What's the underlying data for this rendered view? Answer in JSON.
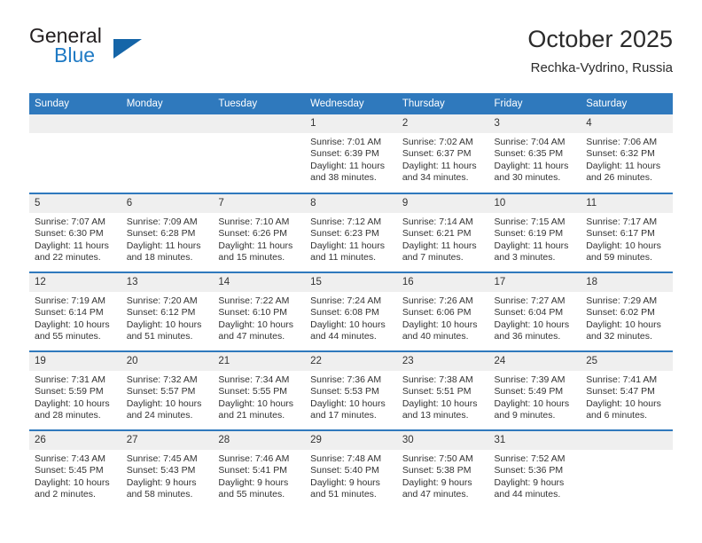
{
  "brand": {
    "name_top": "General",
    "name_bottom": "Blue",
    "triangle_icon": "triangle-icon",
    "color_dark": "#231f20",
    "color_blue": "#1f7ac4"
  },
  "header": {
    "title": "October 2025",
    "location": "Rechka-Vydrino, Russia"
  },
  "theme": {
    "header_blue": "#2f79bd",
    "row_divider": "#2f79bd",
    "daynum_band": "#efefef",
    "text": "#333333"
  },
  "calendar": {
    "weekdays": [
      "Sunday",
      "Monday",
      "Tuesday",
      "Wednesday",
      "Thursday",
      "Friday",
      "Saturday"
    ],
    "labels": {
      "sunrise": "Sunrise:",
      "sunset": "Sunset:",
      "daylight": "Daylight:"
    },
    "weeks": [
      [
        {
          "day": "",
          "empty": true
        },
        {
          "day": "",
          "empty": true
        },
        {
          "day": "",
          "empty": true
        },
        {
          "day": "1",
          "sunrise": "Sunrise: 7:01 AM",
          "sunset": "Sunset: 6:39 PM",
          "daylight1": "Daylight: 11 hours",
          "daylight2": "and 38 minutes."
        },
        {
          "day": "2",
          "sunrise": "Sunrise: 7:02 AM",
          "sunset": "Sunset: 6:37 PM",
          "daylight1": "Daylight: 11 hours",
          "daylight2": "and 34 minutes."
        },
        {
          "day": "3",
          "sunrise": "Sunrise: 7:04 AM",
          "sunset": "Sunset: 6:35 PM",
          "daylight1": "Daylight: 11 hours",
          "daylight2": "and 30 minutes."
        },
        {
          "day": "4",
          "sunrise": "Sunrise: 7:06 AM",
          "sunset": "Sunset: 6:32 PM",
          "daylight1": "Daylight: 11 hours",
          "daylight2": "and 26 minutes."
        }
      ],
      [
        {
          "day": "5",
          "sunrise": "Sunrise: 7:07 AM",
          "sunset": "Sunset: 6:30 PM",
          "daylight1": "Daylight: 11 hours",
          "daylight2": "and 22 minutes."
        },
        {
          "day": "6",
          "sunrise": "Sunrise: 7:09 AM",
          "sunset": "Sunset: 6:28 PM",
          "daylight1": "Daylight: 11 hours",
          "daylight2": "and 18 minutes."
        },
        {
          "day": "7",
          "sunrise": "Sunrise: 7:10 AM",
          "sunset": "Sunset: 6:26 PM",
          "daylight1": "Daylight: 11 hours",
          "daylight2": "and 15 minutes."
        },
        {
          "day": "8",
          "sunrise": "Sunrise: 7:12 AM",
          "sunset": "Sunset: 6:23 PM",
          "daylight1": "Daylight: 11 hours",
          "daylight2": "and 11 minutes."
        },
        {
          "day": "9",
          "sunrise": "Sunrise: 7:14 AM",
          "sunset": "Sunset: 6:21 PM",
          "daylight1": "Daylight: 11 hours",
          "daylight2": "and 7 minutes."
        },
        {
          "day": "10",
          "sunrise": "Sunrise: 7:15 AM",
          "sunset": "Sunset: 6:19 PM",
          "daylight1": "Daylight: 11 hours",
          "daylight2": "and 3 minutes."
        },
        {
          "day": "11",
          "sunrise": "Sunrise: 7:17 AM",
          "sunset": "Sunset: 6:17 PM",
          "daylight1": "Daylight: 10 hours",
          "daylight2": "and 59 minutes."
        }
      ],
      [
        {
          "day": "12",
          "sunrise": "Sunrise: 7:19 AM",
          "sunset": "Sunset: 6:14 PM",
          "daylight1": "Daylight: 10 hours",
          "daylight2": "and 55 minutes."
        },
        {
          "day": "13",
          "sunrise": "Sunrise: 7:20 AM",
          "sunset": "Sunset: 6:12 PM",
          "daylight1": "Daylight: 10 hours",
          "daylight2": "and 51 minutes."
        },
        {
          "day": "14",
          "sunrise": "Sunrise: 7:22 AM",
          "sunset": "Sunset: 6:10 PM",
          "daylight1": "Daylight: 10 hours",
          "daylight2": "and 47 minutes."
        },
        {
          "day": "15",
          "sunrise": "Sunrise: 7:24 AM",
          "sunset": "Sunset: 6:08 PM",
          "daylight1": "Daylight: 10 hours",
          "daylight2": "and 44 minutes."
        },
        {
          "day": "16",
          "sunrise": "Sunrise: 7:26 AM",
          "sunset": "Sunset: 6:06 PM",
          "daylight1": "Daylight: 10 hours",
          "daylight2": "and 40 minutes."
        },
        {
          "day": "17",
          "sunrise": "Sunrise: 7:27 AM",
          "sunset": "Sunset: 6:04 PM",
          "daylight1": "Daylight: 10 hours",
          "daylight2": "and 36 minutes."
        },
        {
          "day": "18",
          "sunrise": "Sunrise: 7:29 AM",
          "sunset": "Sunset: 6:02 PM",
          "daylight1": "Daylight: 10 hours",
          "daylight2": "and 32 minutes."
        }
      ],
      [
        {
          "day": "19",
          "sunrise": "Sunrise: 7:31 AM",
          "sunset": "Sunset: 5:59 PM",
          "daylight1": "Daylight: 10 hours",
          "daylight2": "and 28 minutes."
        },
        {
          "day": "20",
          "sunrise": "Sunrise: 7:32 AM",
          "sunset": "Sunset: 5:57 PM",
          "daylight1": "Daylight: 10 hours",
          "daylight2": "and 24 minutes."
        },
        {
          "day": "21",
          "sunrise": "Sunrise: 7:34 AM",
          "sunset": "Sunset: 5:55 PM",
          "daylight1": "Daylight: 10 hours",
          "daylight2": "and 21 minutes."
        },
        {
          "day": "22",
          "sunrise": "Sunrise: 7:36 AM",
          "sunset": "Sunset: 5:53 PM",
          "daylight1": "Daylight: 10 hours",
          "daylight2": "and 17 minutes."
        },
        {
          "day": "23",
          "sunrise": "Sunrise: 7:38 AM",
          "sunset": "Sunset: 5:51 PM",
          "daylight1": "Daylight: 10 hours",
          "daylight2": "and 13 minutes."
        },
        {
          "day": "24",
          "sunrise": "Sunrise: 7:39 AM",
          "sunset": "Sunset: 5:49 PM",
          "daylight1": "Daylight: 10 hours",
          "daylight2": "and 9 minutes."
        },
        {
          "day": "25",
          "sunrise": "Sunrise: 7:41 AM",
          "sunset": "Sunset: 5:47 PM",
          "daylight1": "Daylight: 10 hours",
          "daylight2": "and 6 minutes."
        }
      ],
      [
        {
          "day": "26",
          "sunrise": "Sunrise: 7:43 AM",
          "sunset": "Sunset: 5:45 PM",
          "daylight1": "Daylight: 10 hours",
          "daylight2": "and 2 minutes."
        },
        {
          "day": "27",
          "sunrise": "Sunrise: 7:45 AM",
          "sunset": "Sunset: 5:43 PM",
          "daylight1": "Daylight: 9 hours",
          "daylight2": "and 58 minutes."
        },
        {
          "day": "28",
          "sunrise": "Sunrise: 7:46 AM",
          "sunset": "Sunset: 5:41 PM",
          "daylight1": "Daylight: 9 hours",
          "daylight2": "and 55 minutes."
        },
        {
          "day": "29",
          "sunrise": "Sunrise: 7:48 AM",
          "sunset": "Sunset: 5:40 PM",
          "daylight1": "Daylight: 9 hours",
          "daylight2": "and 51 minutes."
        },
        {
          "day": "30",
          "sunrise": "Sunrise: 7:50 AM",
          "sunset": "Sunset: 5:38 PM",
          "daylight1": "Daylight: 9 hours",
          "daylight2": "and 47 minutes."
        },
        {
          "day": "31",
          "sunrise": "Sunrise: 7:52 AM",
          "sunset": "Sunset: 5:36 PM",
          "daylight1": "Daylight: 9 hours",
          "daylight2": "and 44 minutes."
        },
        {
          "day": "",
          "empty": true
        }
      ]
    ]
  }
}
